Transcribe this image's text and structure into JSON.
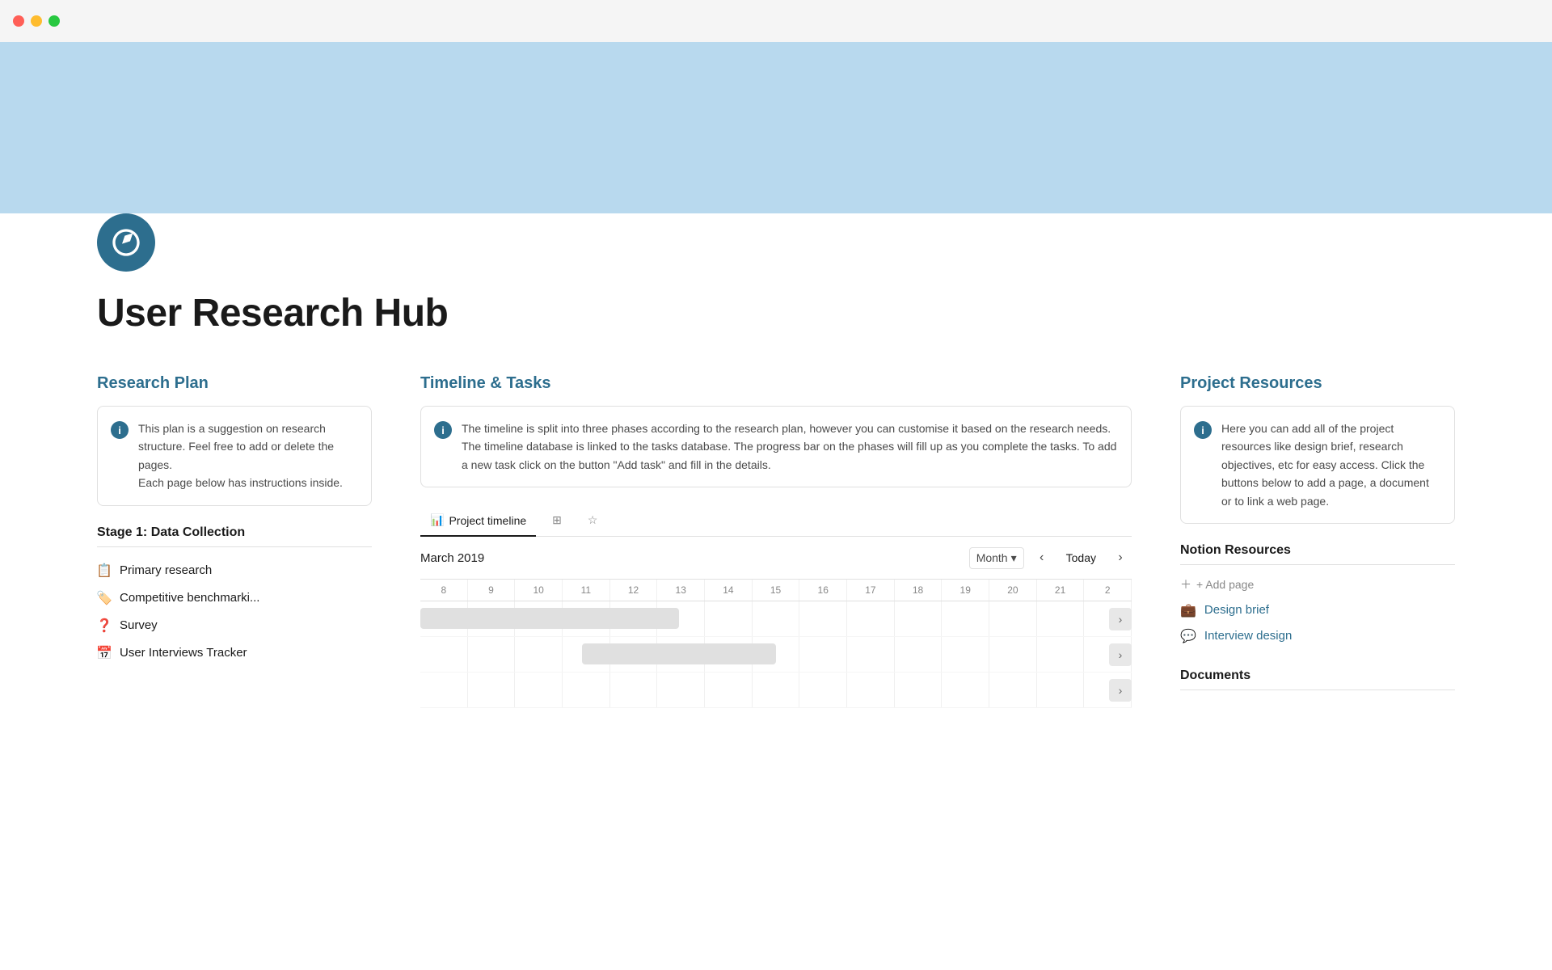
{
  "titleBar": {
    "controls": [
      "red",
      "yellow",
      "green"
    ]
  },
  "page": {
    "title": "User Research Hub",
    "icon": "compass"
  },
  "researchPlan": {
    "heading": "Research Plan",
    "infoBox": {
      "text": "This plan is a suggestion on research structure. Feel free to add or delete the pages.\nEach page below has instructions inside."
    },
    "stage1": {
      "heading": "Stage 1: Data Collection",
      "items": [
        {
          "label": "Primary research",
          "icon": "📋"
        },
        {
          "label": "Competitive benchmarki...",
          "icon": "🏷️"
        },
        {
          "label": "Survey",
          "icon": "❓"
        },
        {
          "label": "User Interviews Tracker",
          "icon": "📅"
        }
      ]
    }
  },
  "timelineTasks": {
    "heading": "Timeline & Tasks",
    "infoBox": {
      "text": "The timeline is split into three phases according to the research plan, however you can customise it based on the research needs. The timeline database is linked to the tasks database. The progress bar on the phases will fill up as you complete the tasks. To add a new task click on the button \"Add task\" and fill in the details."
    },
    "tabs": [
      {
        "label": "Project timeline",
        "icon": "📊",
        "active": true
      },
      {
        "label": "grid",
        "icon": "⊞",
        "active": false
      },
      {
        "label": "star",
        "icon": "☆",
        "active": false
      }
    ],
    "timeline": {
      "date": "March 2019",
      "viewLabel": "Month",
      "todayLabel": "Today",
      "days": [
        "8",
        "9",
        "10",
        "11",
        "12",
        "13",
        "14",
        "15",
        "16",
        "17",
        "18",
        "19",
        "20",
        "21",
        "2"
      ]
    }
  },
  "projectResources": {
    "heading": "Project Resources",
    "infoBox": {
      "text": "Here you can add all of the project resources like design brief, research objectives, etc for easy access. Click the buttons below to add a page, a document or to link a web page."
    },
    "notionResourcesHeading": "Notion Resources",
    "addPageLabel": "+ Add page",
    "links": [
      {
        "label": "Design brief",
        "icon": "💼"
      },
      {
        "label": "Interview design",
        "icon": "💬"
      }
    ],
    "documentsHeading": "Documents"
  }
}
